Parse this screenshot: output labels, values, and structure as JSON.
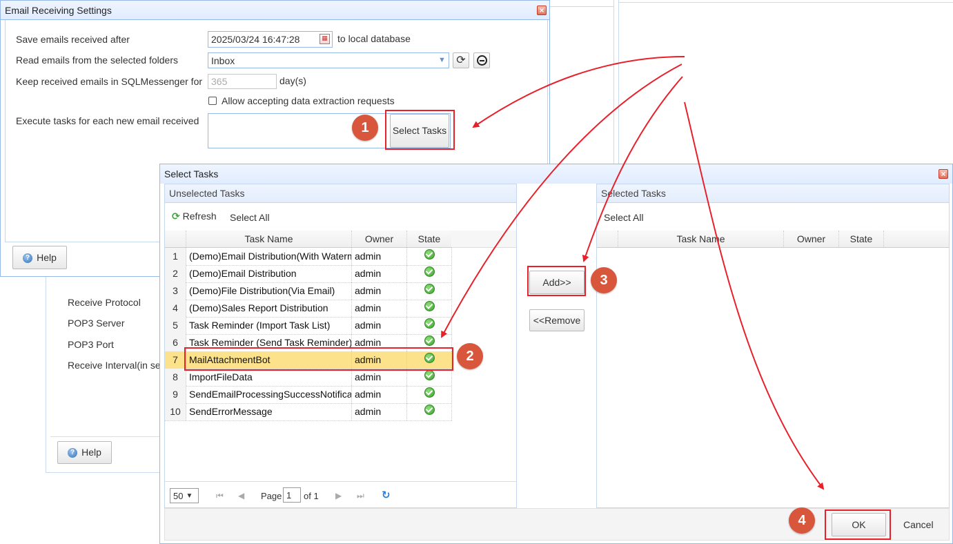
{
  "email_settings": {
    "title": "Email Receiving Settings",
    "save_after_label": "Save emails received after",
    "save_after_value": "2025/03/24 16:47:28",
    "to_local_db": "to local database",
    "read_folders_label": "Read emails from the selected folders",
    "folder_value": "Inbox",
    "keep_label": "Keep received emails in SQLMessenger for",
    "keep_placeholder": "365",
    "days_label": "day(s)",
    "allow_label": "Allow accepting data extraction requests",
    "execute_label": "Execute tasks for each new email received",
    "select_tasks_btn": "Select Tasks",
    "help_btn": "Help"
  },
  "bg_window": {
    "receive_protocol": "Receive Protocol",
    "pop3_server": "POP3 Server",
    "pop3_port": "POP3 Port",
    "receive_interval": "Receive Interval(in se",
    "help_btn": "Help"
  },
  "select_tasks": {
    "title": "Select Tasks",
    "unselected_title": "Unselected Tasks",
    "refresh": "Refresh",
    "select_all": "Select All",
    "selected_title": "Selected Tasks",
    "selected_select_all": "Select All",
    "columns": {
      "task_name": "Task Name",
      "owner": "Owner",
      "state": "State"
    },
    "rows": [
      {
        "n": "1",
        "name": "(Demo)Email Distribution(With Watermark)",
        "owner": "admin"
      },
      {
        "n": "2",
        "name": "(Demo)Email Distribution",
        "owner": "admin"
      },
      {
        "n": "3",
        "name": "(Demo)File Distribution(Via Email)",
        "owner": "admin"
      },
      {
        "n": "4",
        "name": "(Demo)Sales Report Distribution",
        "owner": "admin"
      },
      {
        "n": "5",
        "name": "Task Reminder (Import Task List)",
        "owner": "admin"
      },
      {
        "n": "6",
        "name": "Task Reminder (Send Task Reminder)",
        "owner": "admin"
      },
      {
        "n": "7",
        "name": "MailAttachmentBot",
        "owner": "admin"
      },
      {
        "n": "8",
        "name": "ImportFileData",
        "owner": "admin"
      },
      {
        "n": "9",
        "name": "SendEmailProcessingSuccessNotification",
        "owner": "admin"
      },
      {
        "n": "10",
        "name": "SendErrorMessage",
        "owner": "admin"
      }
    ],
    "add_btn": "Add>>",
    "remove_btn": "<<Remove",
    "page_size": "50",
    "page_label": "Page",
    "page_value": "1",
    "of_label": "of 1",
    "ok_btn": "OK",
    "cancel_btn": "Cancel"
  },
  "badges": [
    "1",
    "2",
    "3",
    "4"
  ],
  "colors": {
    "annotation_red": "#e8202a",
    "badge": "#d8573c",
    "selected_row": "#fce28a",
    "border_blue": "#95b8e7"
  }
}
